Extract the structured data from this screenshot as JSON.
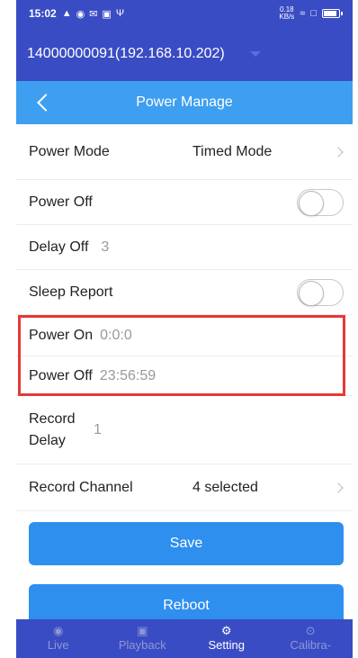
{
  "status_bar": {
    "time": "15:02",
    "left_icons": [
      "app-icon",
      "location-icon",
      "mail-icon",
      "message-icon",
      "usb-icon"
    ],
    "right_icons": [
      "network-speed-icon",
      "wifi-icon",
      "sim-icon",
      "battery-icon"
    ],
    "network_speed": "0.18\nKB/s"
  },
  "device": {
    "label": "14000000091(192.168.10.202)"
  },
  "header": {
    "title": "Power Manage"
  },
  "settings": {
    "power_mode": {
      "label": "Power Mode",
      "value": "Timed Mode"
    },
    "power_off_toggle": {
      "label": "Power Off",
      "on": false
    },
    "delay_off": {
      "label": "Delay Off",
      "value": "3"
    },
    "sleep_report": {
      "label": "Sleep Report",
      "on": false
    },
    "power_on_time": {
      "label": "Power On",
      "value": "0:0:0"
    },
    "power_off_time": {
      "label": "Power Off",
      "value": "23:56:59"
    },
    "record_delay": {
      "label": "Record Delay",
      "value": "1"
    },
    "record_channel": {
      "label": "Record Channel",
      "value": "4 selected"
    }
  },
  "buttons": {
    "save": "Save",
    "reboot": "Reboot"
  },
  "tabs": [
    {
      "label": "Live",
      "icon": "live-icon",
      "active": false
    },
    {
      "label": "Playback",
      "icon": "playback-icon",
      "active": false
    },
    {
      "label": "Setting",
      "icon": "gear-icon",
      "active": true
    },
    {
      "label": "Calibra-",
      "icon": "calibrate-icon",
      "active": false
    }
  ],
  "colors": {
    "status_bar": "#3a4cc4",
    "header": "#3e9ef0",
    "button": "#2f8fee",
    "highlight": "#e53935"
  }
}
